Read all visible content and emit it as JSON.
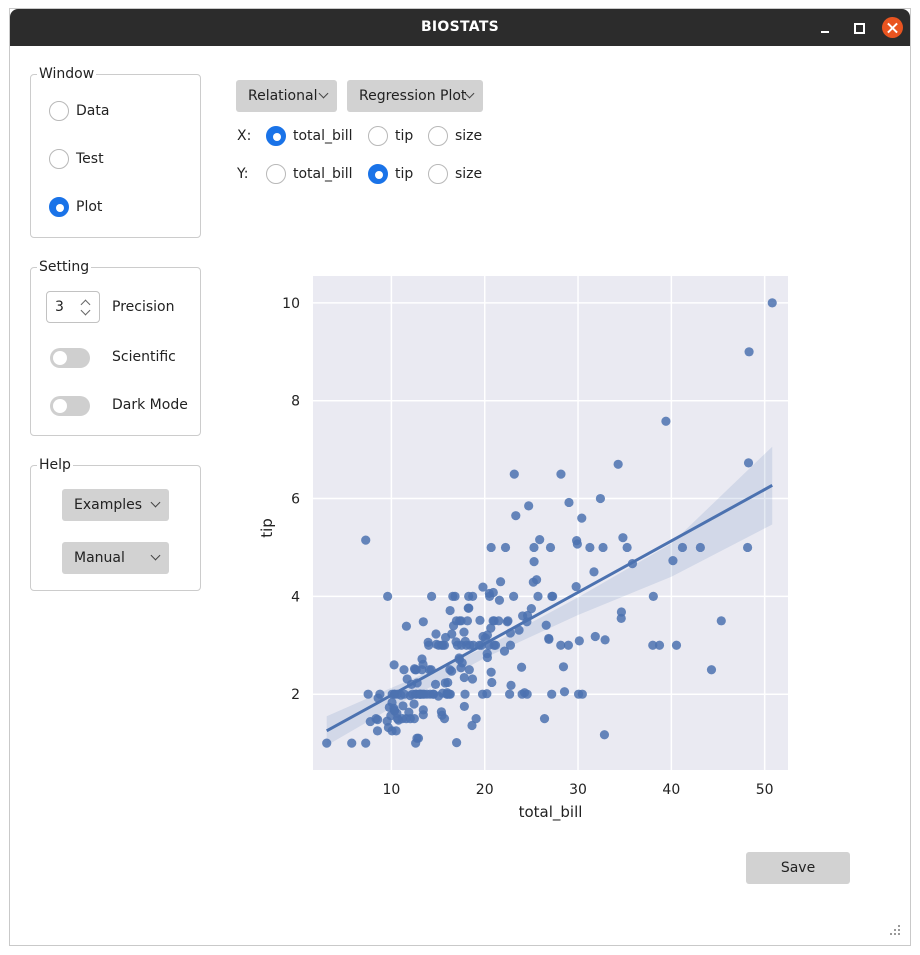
{
  "app": {
    "title": "BIOSTATS"
  },
  "window_group": {
    "label": "Window",
    "options": [
      "Data",
      "Test",
      "Plot"
    ],
    "selected": "Plot"
  },
  "setting_group": {
    "label": "Setting",
    "precision": {
      "value": "3",
      "label": "Precision"
    },
    "scientific": {
      "label": "Scientific",
      "on": false
    },
    "dark_mode": {
      "label": "Dark Mode",
      "on": false
    }
  },
  "help_group": {
    "label": "Help",
    "examples": "Examples",
    "manual": "Manual"
  },
  "plot_controls": {
    "category": "Relational",
    "plot_type": "Regression Plot",
    "x": {
      "label": "X:",
      "options": [
        "total_bill",
        "tip",
        "size"
      ],
      "selected": "total_bill"
    },
    "y": {
      "label": "Y:",
      "options": [
        "total_bill",
        "tip",
        "size"
      ],
      "selected": "tip"
    }
  },
  "save_label": "Save",
  "colors": {
    "accent": "#1a73e8",
    "point": "#4c72b0",
    "plot_bg": "#eaeaf2",
    "close": "#e95420"
  },
  "icons": {
    "dropdown": "chevron-down-icon",
    "close": "close-icon",
    "grip": "resize-grip-icon"
  },
  "chart_data": {
    "type": "scatter",
    "xlabel": "total_bill",
    "ylabel": "tip",
    "xlim": [
      1.6,
      52.5
    ],
    "ylim": [
      0.45,
      10.55
    ],
    "xticks": [
      10,
      20,
      30,
      40,
      50
    ],
    "yticks": [
      2,
      4,
      6,
      8,
      10
    ],
    "grid": true,
    "regression": {
      "x": [
        3.07,
        50.81
      ],
      "y": [
        1.25,
        6.27
      ]
    },
    "confidence_band": {
      "x": [
        3.07,
        10,
        20,
        30,
        40,
        50.81
      ],
      "lower": [
        0.95,
        1.72,
        2.74,
        3.62,
        4.4,
        5.47
      ],
      "upper": [
        1.55,
        2.13,
        2.95,
        3.98,
        5.08,
        7.06
      ]
    },
    "points": [
      [
        3.07,
        1.0
      ],
      [
        5.75,
        1.0
      ],
      [
        7.25,
        1.0
      ],
      [
        7.25,
        5.15
      ],
      [
        7.51,
        2.0
      ],
      [
        7.74,
        1.44
      ],
      [
        8.35,
        1.5
      ],
      [
        8.51,
        1.25
      ],
      [
        8.52,
        1.48
      ],
      [
        8.58,
        1.92
      ],
      [
        8.77,
        2.0
      ],
      [
        9.55,
        1.45
      ],
      [
        9.6,
        4.0
      ],
      [
        9.68,
        1.32
      ],
      [
        9.78,
        1.73
      ],
      [
        9.94,
        1.56
      ],
      [
        10.07,
        1.83
      ],
      [
        10.07,
        1.25
      ],
      [
        10.09,
        2.0
      ],
      [
        10.27,
        1.71
      ],
      [
        10.29,
        2.6
      ],
      [
        10.33,
        1.67
      ],
      [
        10.33,
        2.0
      ],
      [
        10.34,
        1.66
      ],
      [
        10.34,
        2.0
      ],
      [
        10.51,
        1.25
      ],
      [
        10.59,
        1.61
      ],
      [
        10.63,
        2.0
      ],
      [
        10.65,
        1.5
      ],
      [
        10.77,
        1.47
      ],
      [
        11.02,
        1.98
      ],
      [
        11.17,
        1.5
      ],
      [
        11.24,
        1.76
      ],
      [
        11.35,
        2.5
      ],
      [
        11.38,
        2.0
      ],
      [
        11.59,
        1.5
      ],
      [
        11.61,
        3.39
      ],
      [
        11.69,
        2.31
      ],
      [
        11.87,
        1.63
      ],
      [
        12.02,
        1.97
      ],
      [
        12.03,
        1.5
      ],
      [
        12.16,
        2.2
      ],
      [
        12.26,
        2.0
      ],
      [
        12.43,
        1.8
      ],
      [
        12.46,
        1.5
      ],
      [
        12.48,
        2.52
      ],
      [
        12.54,
        2.5
      ],
      [
        12.6,
        1.0
      ],
      [
        12.6,
        2.0
      ],
      [
        12.66,
        2.5
      ],
      [
        12.69,
        2.0
      ],
      [
        12.74,
        1.1
      ],
      [
        12.76,
        2.23
      ],
      [
        12.9,
        1.1
      ],
      [
        13.0,
        2.0
      ],
      [
        13.03,
        2.0
      ],
      [
        13.13,
        2.0
      ],
      [
        13.16,
        2.0
      ],
      [
        13.27,
        2.5
      ],
      [
        13.28,
        2.72
      ],
      [
        13.37,
        2.0
      ],
      [
        13.39,
        2.61
      ],
      [
        13.42,
        1.58
      ],
      [
        13.42,
        1.68
      ],
      [
        13.42,
        3.48
      ],
      [
        13.51,
        2.0
      ],
      [
        13.81,
        2.0
      ],
      [
        13.94,
        3.06
      ],
      [
        14.0,
        3.0
      ],
      [
        14.07,
        2.5
      ],
      [
        14.15,
        2.0
      ],
      [
        14.26,
        2.5
      ],
      [
        14.31,
        4.0
      ],
      [
        14.48,
        2.0
      ],
      [
        14.52,
        2.0
      ],
      [
        14.73,
        2.2
      ],
      [
        14.78,
        3.23
      ],
      [
        14.83,
        3.02
      ],
      [
        15.04,
        1.96
      ],
      [
        15.06,
        3.0
      ],
      [
        15.36,
        1.64
      ],
      [
        15.38,
        3.0
      ],
      [
        15.42,
        1.57
      ],
      [
        15.48,
        2.02
      ],
      [
        15.53,
        3.0
      ],
      [
        15.69,
        1.5
      ],
      [
        15.69,
        3.0
      ],
      [
        15.77,
        2.23
      ],
      [
        15.81,
        3.16
      ],
      [
        15.95,
        2.0
      ],
      [
        15.98,
        2.03
      ],
      [
        16.0,
        2.0
      ],
      [
        16.04,
        2.24
      ],
      [
        16.21,
        2.0
      ],
      [
        16.27,
        2.5
      ],
      [
        16.29,
        3.71
      ],
      [
        16.31,
        2.0
      ],
      [
        16.45,
        2.47
      ],
      [
        16.47,
        3.23
      ],
      [
        16.58,
        4.0
      ],
      [
        16.66,
        3.4
      ],
      [
        16.82,
        4.0
      ],
      [
        16.93,
        3.07
      ],
      [
        16.97,
        3.5
      ],
      [
        16.99,
        1.01
      ],
      [
        17.07,
        3.0
      ],
      [
        17.26,
        2.74
      ],
      [
        17.29,
        2.71
      ],
      [
        17.31,
        3.5
      ],
      [
        17.46,
        2.54
      ],
      [
        17.47,
        3.5
      ],
      [
        17.51,
        3.0
      ],
      [
        17.59,
        2.64
      ],
      [
        17.78,
        3.27
      ],
      [
        17.81,
        2.34
      ],
      [
        17.82,
        1.75
      ],
      [
        17.89,
        2.0
      ],
      [
        17.92,
        3.08
      ],
      [
        18.04,
        3.0
      ],
      [
        18.15,
        3.5
      ],
      [
        18.24,
        3.76
      ],
      [
        18.28,
        4.0
      ],
      [
        18.29,
        3.76
      ],
      [
        18.35,
        2.5
      ],
      [
        18.43,
        3.0
      ],
      [
        18.64,
        1.36
      ],
      [
        18.69,
        2.31
      ],
      [
        18.71,
        4.0
      ],
      [
        18.78,
        3.0
      ],
      [
        19.08,
        1.5
      ],
      [
        19.44,
        3.0
      ],
      [
        19.49,
        3.51
      ],
      [
        19.65,
        3.0
      ],
      [
        19.77,
        2.0
      ],
      [
        19.81,
        4.19
      ],
      [
        19.82,
        3.18
      ],
      [
        20.08,
        3.15
      ],
      [
        20.23,
        2.01
      ],
      [
        20.27,
        2.83
      ],
      [
        20.29,
        2.75
      ],
      [
        20.29,
        3.21
      ],
      [
        20.45,
        3.0
      ],
      [
        20.49,
        4.06
      ],
      [
        20.53,
        4.0
      ],
      [
        20.65,
        3.35
      ],
      [
        20.69,
        2.45
      ],
      [
        20.69,
        5.0
      ],
      [
        20.76,
        2.24
      ],
      [
        20.9,
        3.5
      ],
      [
        20.92,
        4.08
      ],
      [
        21.01,
        3.5
      ],
      [
        21.01,
        3.0
      ],
      [
        21.16,
        3.0
      ],
      [
        21.5,
        3.5
      ],
      [
        21.58,
        3.92
      ],
      [
        21.7,
        4.3
      ],
      [
        22.12,
        2.88
      ],
      [
        22.23,
        5.0
      ],
      [
        22.42,
        3.48
      ],
      [
        22.49,
        3.5
      ],
      [
        22.67,
        2.0
      ],
      [
        22.75,
        3.25
      ],
      [
        22.76,
        3.0
      ],
      [
        22.82,
        2.18
      ],
      [
        23.1,
        4.0
      ],
      [
        23.17,
        6.5
      ],
      [
        23.33,
        5.65
      ],
      [
        23.68,
        3.31
      ],
      [
        23.95,
        2.55
      ],
      [
        24.01,
        2.0
      ],
      [
        24.06,
        3.6
      ],
      [
        24.27,
        2.03
      ],
      [
        24.52,
        3.48
      ],
      [
        24.55,
        2.0
      ],
      [
        24.59,
        3.61
      ],
      [
        24.71,
        5.85
      ],
      [
        25.0,
        3.75
      ],
      [
        25.21,
        4.29
      ],
      [
        25.28,
        5.0
      ],
      [
        25.29,
        4.71
      ],
      [
        25.56,
        4.34
      ],
      [
        25.71,
        4.0
      ],
      [
        25.89,
        5.16
      ],
      [
        26.41,
        1.5
      ],
      [
        26.59,
        3.41
      ],
      [
        26.86,
        3.14
      ],
      [
        26.88,
        3.12
      ],
      [
        27.05,
        5.0
      ],
      [
        27.18,
        2.0
      ],
      [
        27.2,
        4.0
      ],
      [
        27.28,
        4.0
      ],
      [
        28.15,
        3.0
      ],
      [
        28.17,
        6.5
      ],
      [
        28.44,
        2.56
      ],
      [
        28.55,
        2.05
      ],
      [
        28.97,
        3.0
      ],
      [
        29.03,
        5.92
      ],
      [
        29.8,
        4.2
      ],
      [
        29.85,
        5.14
      ],
      [
        29.93,
        5.07
      ],
      [
        30.06,
        2.0
      ],
      [
        30.14,
        3.09
      ],
      [
        30.4,
        5.6
      ],
      [
        30.46,
        2.0
      ],
      [
        31.27,
        5.0
      ],
      [
        31.71,
        4.5
      ],
      [
        31.85,
        3.18
      ],
      [
        32.4,
        6.0
      ],
      [
        32.68,
        5.0
      ],
      [
        32.83,
        1.17
      ],
      [
        32.9,
        3.11
      ],
      [
        34.3,
        6.7
      ],
      [
        34.63,
        3.55
      ],
      [
        34.65,
        3.68
      ],
      [
        34.81,
        5.2
      ],
      [
        35.26,
        5.0
      ],
      [
        35.83,
        4.67
      ],
      [
        38.01,
        3.0
      ],
      [
        38.07,
        4.0
      ],
      [
        38.73,
        3.0
      ],
      [
        39.42,
        7.58
      ],
      [
        40.17,
        4.73
      ],
      [
        40.55,
        3.0
      ],
      [
        41.19,
        5.0
      ],
      [
        43.11,
        5.0
      ],
      [
        44.3,
        2.5
      ],
      [
        45.35,
        3.5
      ],
      [
        48.17,
        5.0
      ],
      [
        48.27,
        6.73
      ],
      [
        48.33,
        9.0
      ],
      [
        50.81,
        10.0
      ]
    ]
  }
}
